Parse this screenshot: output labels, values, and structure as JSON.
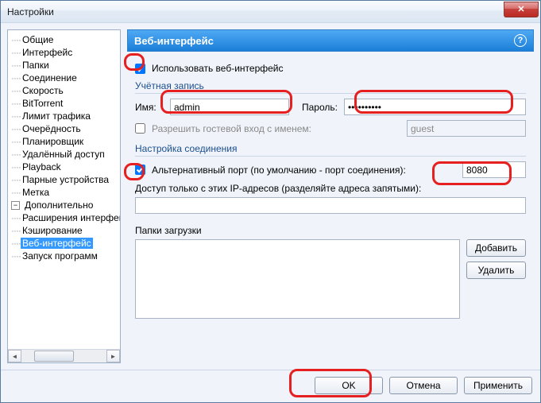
{
  "window": {
    "title": "Настройки"
  },
  "tree": {
    "items": [
      "Общие",
      "Интерфейс",
      "Папки",
      "Соединение",
      "Скорость",
      "BitTorrent",
      "Лимит трафика",
      "Очерёдность",
      "Планировщик",
      "Удалённый доступ",
      "Playback",
      "Парные устройства",
      "Метка"
    ],
    "advanced_label": "Дополнительно",
    "advanced_items": [
      "Расширения интерфейса",
      "Кэширование",
      "Веб-интерфейс",
      "Запуск программ"
    ]
  },
  "panel": {
    "title": "Веб-интерфейс",
    "enable_webui": "Использовать веб-интерфейс",
    "account_group": "Учётная запись",
    "name_label": "Имя:",
    "name_value": "admin",
    "password_label": "Пароль:",
    "password_value": "••••••••••",
    "guest_label": "Разрешить гостевой вход с именем:",
    "guest_value": "guest",
    "conn_group": "Настройка соединения",
    "alt_port_label": "Альтернативный порт (по умолчанию - порт соединения):",
    "alt_port_value": "8080",
    "ip_access_label": "Доступ только с этих IP-адресов (разделяйте адреса запятыми):",
    "download_folders_label": "Папки загрузки",
    "add_btn": "Добавить",
    "del_btn": "Удалить"
  },
  "footer": {
    "ok": "OK",
    "cancel": "Отмена",
    "apply": "Применить"
  }
}
